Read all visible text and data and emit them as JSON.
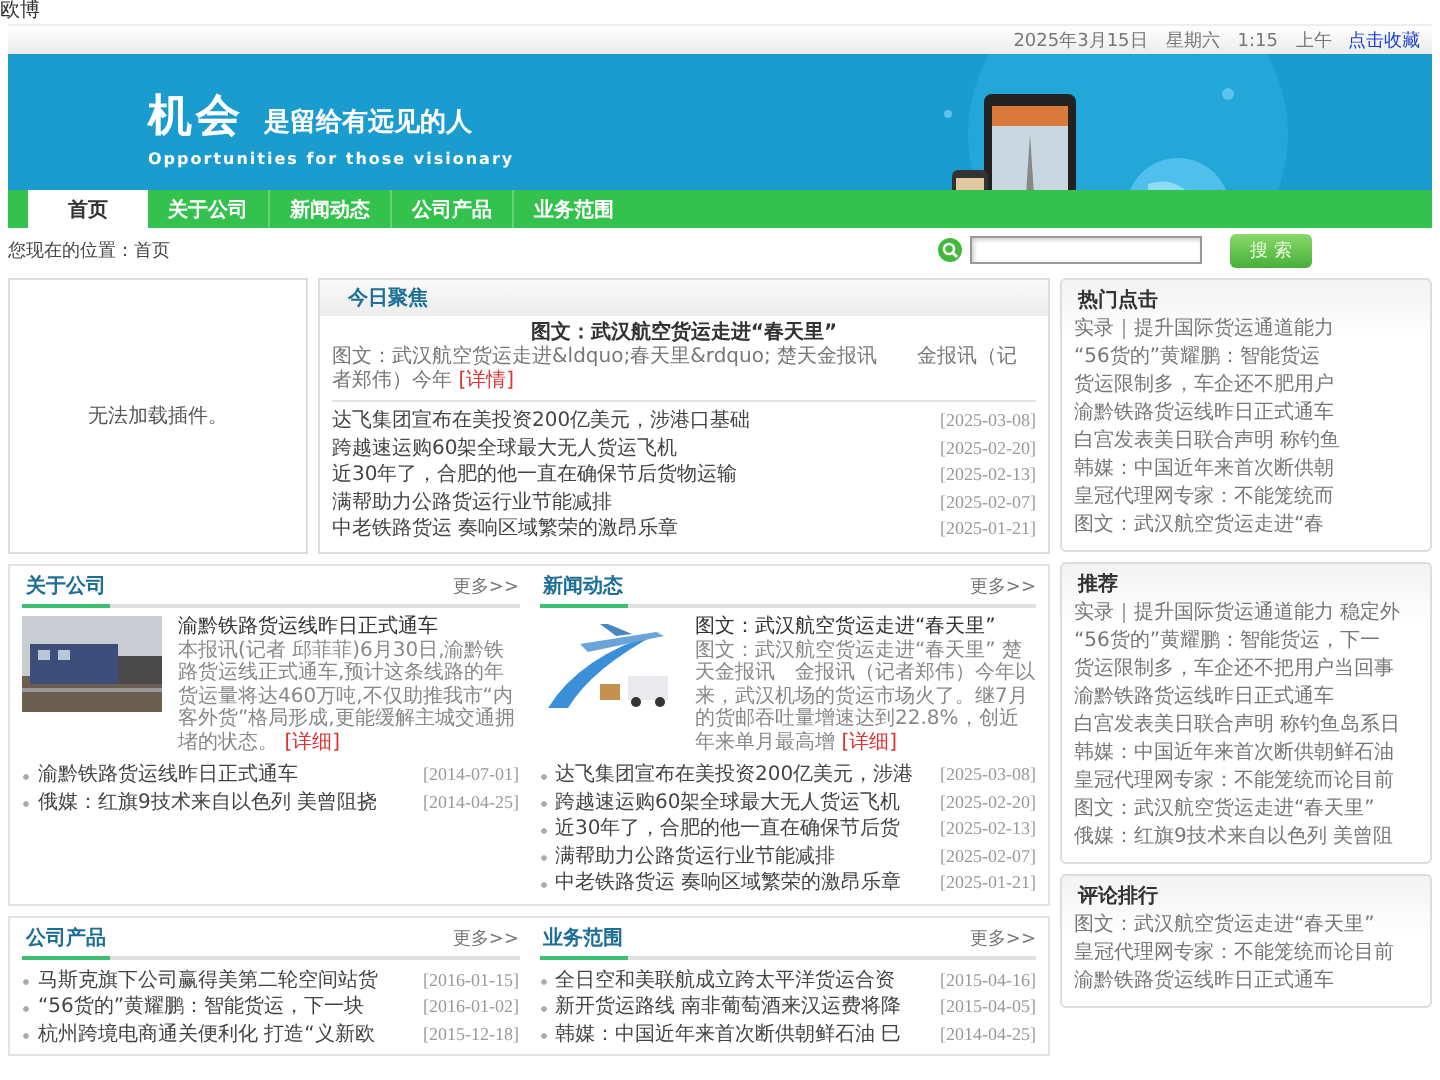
{
  "corner_text": "欧博",
  "top_bar": {
    "date": "2025年3月15日　星期六　1:15　上午",
    "bookmark_link": "点击收藏"
  },
  "banner": {
    "kind": "picture",
    "headline": "机会",
    "tagline": "是留给有远见的人",
    "subtitle": "Opportunities for those visionary"
  },
  "nav": [
    {
      "label": "首页",
      "selected": true
    },
    {
      "label": "关于公司",
      "selected": false
    },
    {
      "label": "新闻动态",
      "selected": false
    },
    {
      "label": "公司产品",
      "selected": false
    },
    {
      "label": "业务范围",
      "selected": false
    }
  ],
  "breadcrumb": "您现在的位置：首页",
  "search": {
    "button": "搜 索"
  },
  "plugin_notice": "无法加载插件。",
  "focus": {
    "title": "今日聚焦",
    "headline": "图文：武汉航空货运走进“春天里”",
    "summary": "图文：武汉航空货运走进&ldquo;春天里&rdquo; 楚天金报讯　　金报讯（记者郑伟）今年",
    "more_link": "[详情]",
    "items": [
      {
        "title": "达飞集团宣布在美投资200亿美元，涉港口基础",
        "date": "[2025-03-08]"
      },
      {
        "title": "跨越速运购60架全球最大无人货运飞机",
        "date": "[2025-02-20]"
      },
      {
        "title": "近30年了，合肥的他一直在确保节后货物运输",
        "date": "[2025-02-13]"
      },
      {
        "title": "满帮助力公路货运行业节能减排",
        "date": "[2025-02-07]"
      },
      {
        "title": "中老铁路货运 奏响区域繁荣的激昂乐章",
        "date": "[2025-01-21]"
      }
    ]
  },
  "sections": [
    {
      "title": "关于公司",
      "more": "更多>>",
      "feature": {
        "kind": "picture",
        "title": "渝黔铁路货运线昨日正式通车",
        "body": "本报讯(记者 邱菲菲)6月30日,渝黔铁路货运线正式通车,预计这条线路的年货运量将达460万吨,不仅助推我市“内客外货”格局形成,更能缓解主城交通拥堵的状态。",
        "more_link": "[详细]"
      },
      "items": [
        {
          "title": "渝黔铁路货运线昨日正式通车",
          "date": "[2014-07-01]"
        },
        {
          "title": "俄媒：红旗9技术来自以色列 美曾阻挠",
          "date": "[2014-04-25]"
        }
      ]
    },
    {
      "title": "新闻动态",
      "more": "更多>>",
      "feature": {
        "kind": "picture",
        "title": "图文：武汉航空货运走进“春天里”",
        "body": "图文：武汉航空货运走进“春天里” 楚天金报讯　金报讯（记者郑伟）今年以来，武汉机场的货运市场火了。继7月的货邮吞吐量增速达到22.8%，创近年来单月最高增",
        "more_link": "[详细]"
      },
      "items": [
        {
          "title": "达飞集团宣布在美投资200亿美元，涉港",
          "date": "[2025-03-08]"
        },
        {
          "title": "跨越速运购60架全球最大无人货运飞机",
          "date": "[2025-02-20]"
        },
        {
          "title": "近30年了，合肥的他一直在确保节后货",
          "date": "[2025-02-13]"
        },
        {
          "title": "满帮助力公路货运行业节能减排",
          "date": "[2025-02-07]"
        },
        {
          "title": "中老铁路货运 奏响区域繁荣的激昂乐章",
          "date": "[2025-01-21]"
        }
      ]
    },
    {
      "title": "公司产品",
      "more": "更多>>",
      "items": [
        {
          "title": "马斯克旗下公司赢得美第二轮空间站货",
          "date": "[2016-01-15]"
        },
        {
          "title": "“56货的”黄耀鹏：智能货运，下一块",
          "date": "[2016-01-02]"
        },
        {
          "title": "杭州跨境电商通关便利化 打造“义新欧",
          "date": "[2015-12-18]"
        }
      ]
    },
    {
      "title": "业务范围",
      "more": "更多>>",
      "items": [
        {
          "title": "全日空和美联航成立跨太平洋货运合资",
          "date": "[2015-04-16]"
        },
        {
          "title": "新开货运路线 南非葡萄酒来汉运费将降",
          "date": "[2015-04-05]"
        },
        {
          "title": "韩媒：中国近年来首次断供朝鲜石油 巳",
          "date": "[2014-04-25]"
        }
      ]
    }
  ],
  "sidebar": [
    {
      "title": "热门点击",
      "items": [
        "实录｜提升国际货运通道能力",
        "“56货的”黄耀鹏：智能货运",
        "货运限制多，车企还不肥用户",
        "渝黔铁路货运线昨日正式通车",
        "白宫发表美日联合声明 称钓鱼",
        "韩媒：中国近年来首次断供朝",
        "皇冠代理网专家：不能笼统而",
        "图文：武汉航空货运走进“春"
      ]
    },
    {
      "title": "推荐",
      "items": [
        "实录｜提升国际货运通道能力 稳定外",
        "“56货的”黄耀鹏：智能货运，下一",
        "货运限制多，车企还不把用户当回事",
        "渝黔铁路货运线昨日正式通车",
        "白宫发表美日联合声明 称钓鱼岛系日",
        "韩媒：中国近年来首次断供朝鲜石油",
        "皇冠代理网专家：不能笼统而论目前",
        "图文：武汉航空货运走进“春天里”",
        "俄媒：红旗9技术来自以色列 美曾阻"
      ]
    },
    {
      "title": "评论排行",
      "items": [
        "图文：武汉航空货运走进“春天里”",
        "皇冠代理网专家：不能笼统而论目前",
        "渝黔铁路货运线昨日正式通车"
      ]
    }
  ]
}
